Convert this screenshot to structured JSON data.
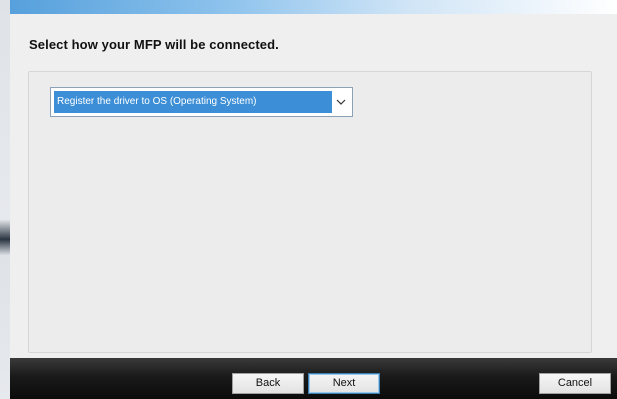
{
  "dialog": {
    "prompt": "Select how your MFP will be connected."
  },
  "connection_select": {
    "selected": "Register the driver to OS (Operating System)",
    "icon": "chevron-down-icon"
  },
  "buttons": {
    "back": "Back",
    "next": "Next",
    "cancel": "Cancel"
  },
  "colors": {
    "selection": "#3c8fd6",
    "title_accent": "#56a0dc",
    "footer": "#111111"
  }
}
